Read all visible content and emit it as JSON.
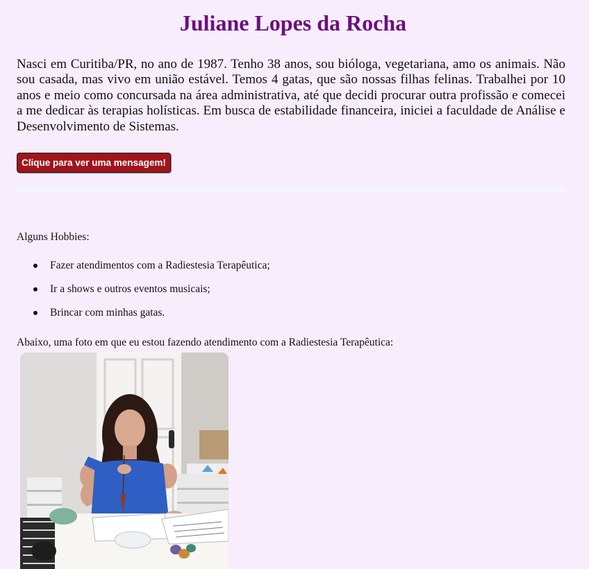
{
  "header": {
    "title": "Juliane Lopes da Rocha"
  },
  "intro": {
    "text": "Nasci em Curitiba/PR, no ano de 1987. Tenho 38 anos, sou bióloga, vegetariana, amo os animais. Não sou casada, mas vivo em união estável. Temos 4 gatas, que são nossas filhas felinas. Trabalhei por 10 anos e meio como concursada na área administrativa, até que decidi procurar outra profissão e comecei a me dedicar às terapias holísticas. Em busca de estabilidade financeira, iniciei a faculdade de Análise e Desenvolvimento de Sistemas."
  },
  "message_button": {
    "label": "Clique para ver uma mensagem!"
  },
  "message_area": {
    "text": ""
  },
  "hobbies": {
    "label": "Alguns Hobbies:",
    "items": [
      "Fazer atendimentos com a Radiestesia Terapêutica;",
      "Ir a shows e outros eventos musicais;",
      "Brincar com minhas gatas."
    ]
  },
  "photo": {
    "caption": "Abaixo, uma foto em que eu estou fazendo atendimento com a Radiestesia Terapêutica:"
  },
  "colors": {
    "page_background": "#f8edfc",
    "title": "#6b0f7e",
    "button_background": "#a0151c",
    "message_area": "#f2f4fe"
  }
}
